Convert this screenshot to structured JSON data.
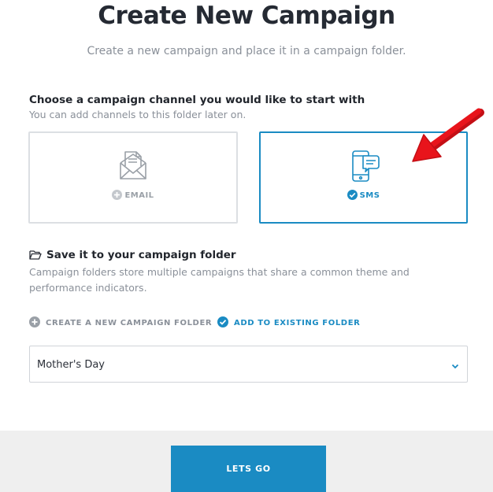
{
  "header": {
    "title": "Create New Campaign",
    "subtitle": "Create a new campaign and place it in a campaign folder."
  },
  "channel_section": {
    "title": "Choose a campaign channel you would like to start with",
    "subtitle": "You can add channels to this folder later on.",
    "channels": [
      {
        "label": "EMAIL",
        "icon": "envelope-icon",
        "selected": false
      },
      {
        "label": "SMS",
        "icon": "phone-chat-icon",
        "selected": true
      }
    ]
  },
  "folder_section": {
    "title": "Save it to your campaign folder",
    "description": "Campaign folders store multiple campaigns that share a common theme and performance indicators.",
    "options": [
      {
        "label": "CREATE A NEW CAMPAIGN FOLDER",
        "selected": false
      },
      {
        "label": "ADD TO EXISTING FOLDER",
        "selected": true
      }
    ],
    "folder_select_value": "Mother's Day"
  },
  "footer": {
    "go_label": "LETS GO"
  },
  "colors": {
    "accent": "#1a8bc3",
    "annotation_arrow": "#e8141b",
    "footer_bg": "#efefef"
  }
}
